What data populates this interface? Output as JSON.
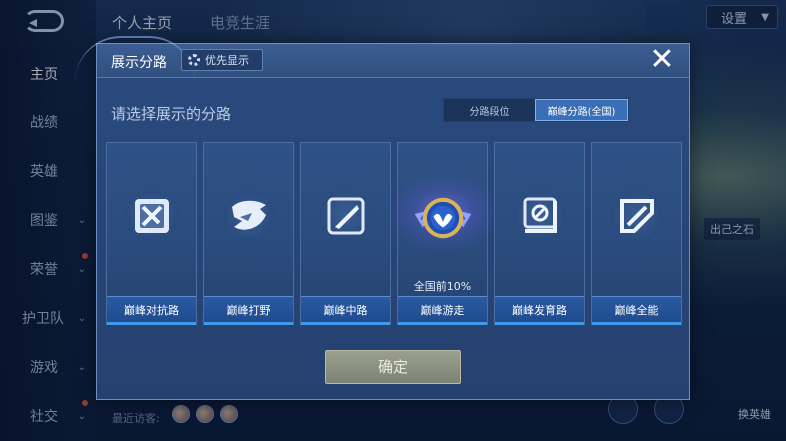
{
  "background": {
    "top_tabs": [
      {
        "label": "个人主页",
        "active": true
      },
      {
        "label": "电竞生涯",
        "active": false
      }
    ],
    "settings_label": "设置",
    "sidebar": [
      {
        "label": "主页",
        "active": true,
        "has_chevron": false
      },
      {
        "label": "战绩",
        "active": false,
        "has_chevron": false
      },
      {
        "label": "英雄",
        "active": false,
        "has_chevron": false
      },
      {
        "label": "图鉴",
        "active": false,
        "has_chevron": true
      },
      {
        "label": "荣誉",
        "active": false,
        "has_chevron": true
      },
      {
        "label": "护卫队",
        "active": false,
        "has_chevron": true
      },
      {
        "label": "游戏",
        "active": false,
        "has_chevron": true
      },
      {
        "label": "社交",
        "active": false,
        "has_chevron": true
      }
    ],
    "recent_visitors_label": "最近访客:",
    "right_chip_label": "出己之石",
    "right_bottom_label": "换英雄"
  },
  "modal": {
    "title": "展示分路",
    "priority_button": "优先显示",
    "close_symbol": "✕",
    "section_title": "请选择展示的分路",
    "tabs": [
      {
        "label": "分路段位",
        "active": false
      },
      {
        "label": "巅峰分路(全国)",
        "active": true
      }
    ],
    "lanes": [
      {
        "label": "巅峰对抗路",
        "icon": "clash-lane-icon",
        "rank": "",
        "highlighted": false
      },
      {
        "label": "巅峰打野",
        "icon": "jungle-dragon-icon",
        "rank": "",
        "highlighted": false
      },
      {
        "label": "巅峰中路",
        "icon": "mid-lane-icon",
        "rank": "",
        "highlighted": false
      },
      {
        "label": "巅峰游走",
        "icon": "roam-wing-badge-icon",
        "rank": "全国前10%",
        "highlighted": true
      },
      {
        "label": "巅峰发育路",
        "icon": "farm-lane-icon",
        "rank": "",
        "highlighted": false
      },
      {
        "label": "巅峰全能",
        "icon": "all-round-icon",
        "rank": "",
        "highlighted": false
      }
    ],
    "confirm_label": "确定"
  },
  "colors": {
    "accent_blue": "#3a6fb8",
    "card_label_blue": "#1e4a8e",
    "confirm_button": "#8a9080",
    "glow_purple": "#9678ff"
  }
}
